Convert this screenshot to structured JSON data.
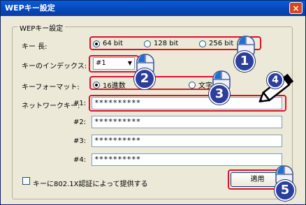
{
  "window": {
    "title": "WEPキー設定",
    "close_glyph": "×"
  },
  "group": {
    "legend": "WEPキー設定"
  },
  "key_length": {
    "label": "キー 長:",
    "options": [
      "64 bit",
      "128 bit",
      "256 bit"
    ],
    "selected": "64 bit"
  },
  "index": {
    "label": "キーのインデックス:",
    "value": "#1",
    "arrow": "▼"
  },
  "format": {
    "label": "キーフォーマット:",
    "options": [
      "16進数",
      "文字"
    ],
    "selected": "16進数"
  },
  "network_key": {
    "label": "ネットワークキー:",
    "keys": [
      {
        "id": "#1:",
        "value": "**********"
      },
      {
        "id": "#2:",
        "value": "**********"
      },
      {
        "id": "#3:",
        "value": "**********"
      },
      {
        "id": "#4:",
        "value": "**********"
      }
    ]
  },
  "provide_8021x": {
    "label": "キーに802.1X認証によって提供する",
    "checked": false
  },
  "apply_button": {
    "label": "適用"
  },
  "callouts": [
    "1",
    "2",
    "3",
    "4",
    "5"
  ],
  "colors": {
    "highlight": "#e0102b",
    "badge": "#2c3e9e",
    "titlebar": "#0a5bd6"
  }
}
